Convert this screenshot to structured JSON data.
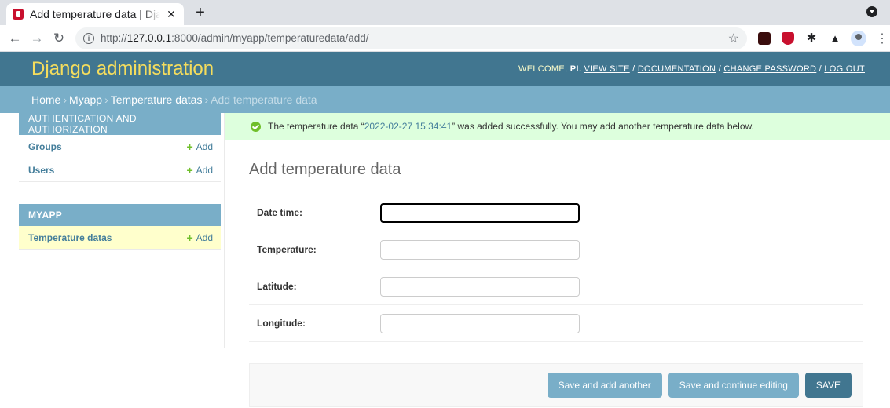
{
  "browser": {
    "tab_title": "Add temperature data | Django site admin",
    "url_prefix": "http://",
    "url_host": "127.0.0.1",
    "url_rest": ":8000/admin/myapp/temperaturedata/add/"
  },
  "header": {
    "branding": "Django administration",
    "welcome": "WELCOME,",
    "username": "PI",
    "view_site": "VIEW SITE",
    "documentation": "DOCUMENTATION",
    "change_password": "CHANGE PASSWORD",
    "log_out": "LOG OUT"
  },
  "breadcrumbs": {
    "home": "Home",
    "app": "Myapp",
    "model": "Temperature datas",
    "current": "Add temperature data"
  },
  "sidebar": {
    "auth_caption": "AUTHENTICATION AND AUTHORIZATION",
    "groups": "Groups",
    "users": "Users",
    "myapp_caption": "MYAPP",
    "temperature_datas": "Temperature datas",
    "add_label": "Add"
  },
  "message": {
    "prefix": "The temperature data “",
    "object": "2022-02-27 15:34:41",
    "suffix": "” was added successfully. You may add another temperature data below."
  },
  "page_title": "Add temperature data",
  "form": {
    "date_time_label": "Date time:",
    "temperature_label": "Temperature:",
    "latitude_label": "Latitude:",
    "longitude_label": "Longitude:",
    "date_time_value": "",
    "temperature_value": "",
    "latitude_value": "",
    "longitude_value": ""
  },
  "buttons": {
    "save_add_another": "Save and add another",
    "save_continue": "Save and continue editing",
    "save": "SAVE"
  },
  "colors": {
    "header": "#417690",
    "branding": "#f5dd5d",
    "breadcrumbs": "#79aec8",
    "success_bg": "#dfd"
  }
}
